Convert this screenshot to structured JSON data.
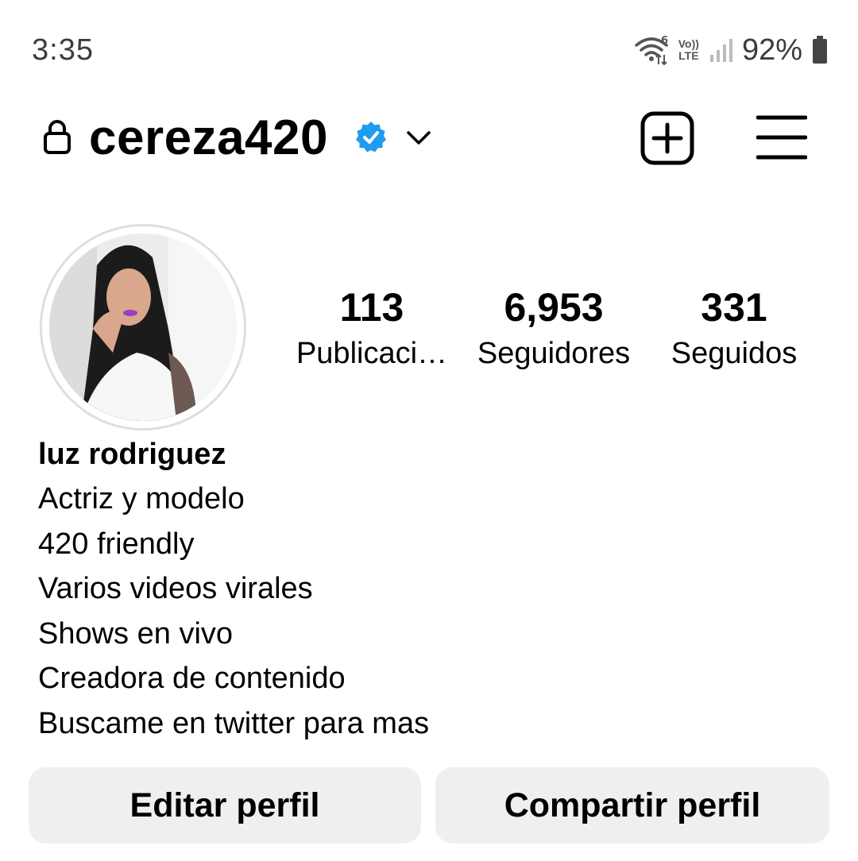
{
  "status_bar": {
    "time": "3:35",
    "battery_percent": "92%",
    "network": "LTE",
    "volte_label": "Vo)) LTE",
    "icons": [
      "wifi-icon",
      "volte-icon",
      "signal-icon",
      "battery-icon"
    ]
  },
  "header": {
    "username": "cereza420",
    "verified": true,
    "icons": [
      "lock-icon",
      "verified-badge-icon",
      "chevron-down-icon",
      "add-post-icon",
      "hamburger-menu-icon"
    ]
  },
  "stats": [
    {
      "value": "113",
      "label": "Publicaci…"
    },
    {
      "value": "6,953",
      "label": "Seguidores"
    },
    {
      "value": "331",
      "label": "Seguidos"
    }
  ],
  "bio": {
    "name": "luz rodriguez",
    "lines": [
      "Actriz y modelo",
      "420 friendly",
      "Varios videos virales",
      "Shows en vivo",
      "Creadora de contenido",
      "Buscame en twitter para mas"
    ]
  },
  "buttons": {
    "edit_profile": "Editar perfil",
    "share_profile": "Compartir perfil"
  },
  "colors": {
    "verified_blue": "#1f9bf0",
    "button_bg": "#efefef",
    "status_text": "#3c3c3c"
  }
}
